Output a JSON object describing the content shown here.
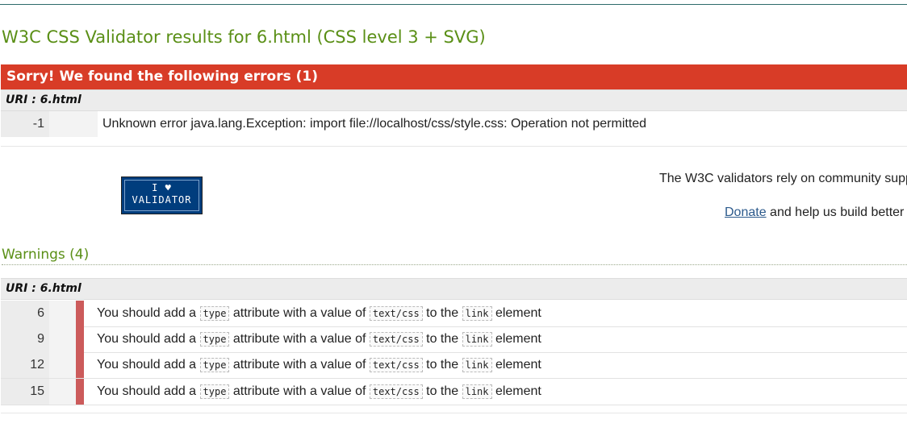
{
  "page": {
    "title": "W3C CSS Validator results for 6.html (CSS level 3 + SVG)"
  },
  "errors": {
    "banner": "Sorry! We found the following errors (1)",
    "uri_label": "URI : 6.html",
    "items": [
      {
        "line": "-1",
        "message": "Unknown error java.lang.Exception: import file://localhost/css/style.css: Operation not permitted"
      }
    ]
  },
  "support": {
    "badge_line1": "I ♥",
    "badge_line2": "VALIDATOR",
    "text": "The W3C validators rely on community supp",
    "donate_label": "Donate",
    "donate_suffix": " and help us build better"
  },
  "warnings": {
    "heading": "Warnings (4)",
    "uri_label": "URI : 6.html",
    "items": [
      {
        "line": "6",
        "pre": "You should add a ",
        "code1": "type",
        "mid": " attribute with a value of ",
        "code2": "text/css",
        "mid2": " to the ",
        "code3": "link",
        "post": " element"
      },
      {
        "line": "9",
        "pre": "You should add a ",
        "code1": "type",
        "mid": " attribute with a value of ",
        "code2": "text/css",
        "mid2": " to the ",
        "code3": "link",
        "post": " element"
      },
      {
        "line": "12",
        "pre": "You should add a ",
        "code1": "type",
        "mid": " attribute with a value of ",
        "code2": "text/css",
        "mid2": " to the ",
        "code3": "link",
        "post": " element"
      },
      {
        "line": "15",
        "pre": "You should add a ",
        "code1": "type",
        "mid": " attribute with a value of ",
        "code2": "text/css",
        "mid2": " to the ",
        "code3": "link",
        "post": " element"
      }
    ]
  },
  "colors": {
    "heading_green": "#5a8f16",
    "error_red": "#d83c27",
    "warning_bar": "#cc5b5b",
    "badge_blue": "#003d7d",
    "link_blue": "#2c5a8c"
  }
}
